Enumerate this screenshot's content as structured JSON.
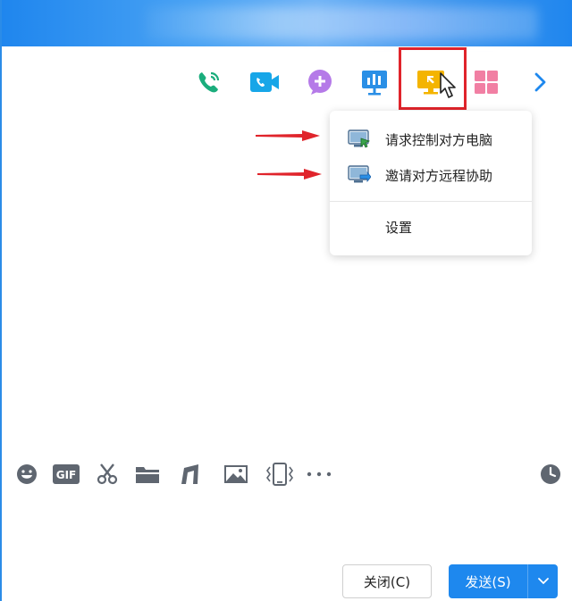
{
  "window": {
    "title": ""
  },
  "toolbar": {
    "items": [
      {
        "name": "voice-call",
        "icon": "phone-icon",
        "color": "#1aad7c"
      },
      {
        "name": "video-call",
        "icon": "video-camera-icon",
        "color": "#17a6e8"
      },
      {
        "name": "add-member",
        "icon": "plus-bubble-icon",
        "color": "#b57ae8"
      },
      {
        "name": "share-screen",
        "icon": "presentation-icon",
        "color": "#2a8fe6"
      },
      {
        "name": "remote-assist",
        "icon": "remote-desktop-icon",
        "color": "#f4b400"
      },
      {
        "name": "apps",
        "icon": "grid-icon",
        "color": "#f17fa3"
      },
      {
        "name": "more",
        "icon": "chevron-right-icon",
        "color": "#1e88ee"
      }
    ]
  },
  "remote_menu": {
    "items": [
      {
        "label": "请求控制对方电脑",
        "icon": "monitor-control-icon"
      },
      {
        "label": "邀请对方远程协助",
        "icon": "monitor-invite-icon"
      }
    ],
    "settings_label": "设置"
  },
  "input_toolbar": {
    "items": [
      "emoji-icon",
      "gif-icon",
      "scissors-icon",
      "folder-icon",
      "music-note-icon",
      "image-icon",
      "shake-icon",
      "more-dots-icon"
    ],
    "history": "clock-icon",
    "gif_text": "GIF"
  },
  "buttons": {
    "close_label": "关闭(C)",
    "send_label": "发送(S)"
  },
  "colors": {
    "accent": "#1e88ee",
    "annotation": "#e0242b"
  }
}
